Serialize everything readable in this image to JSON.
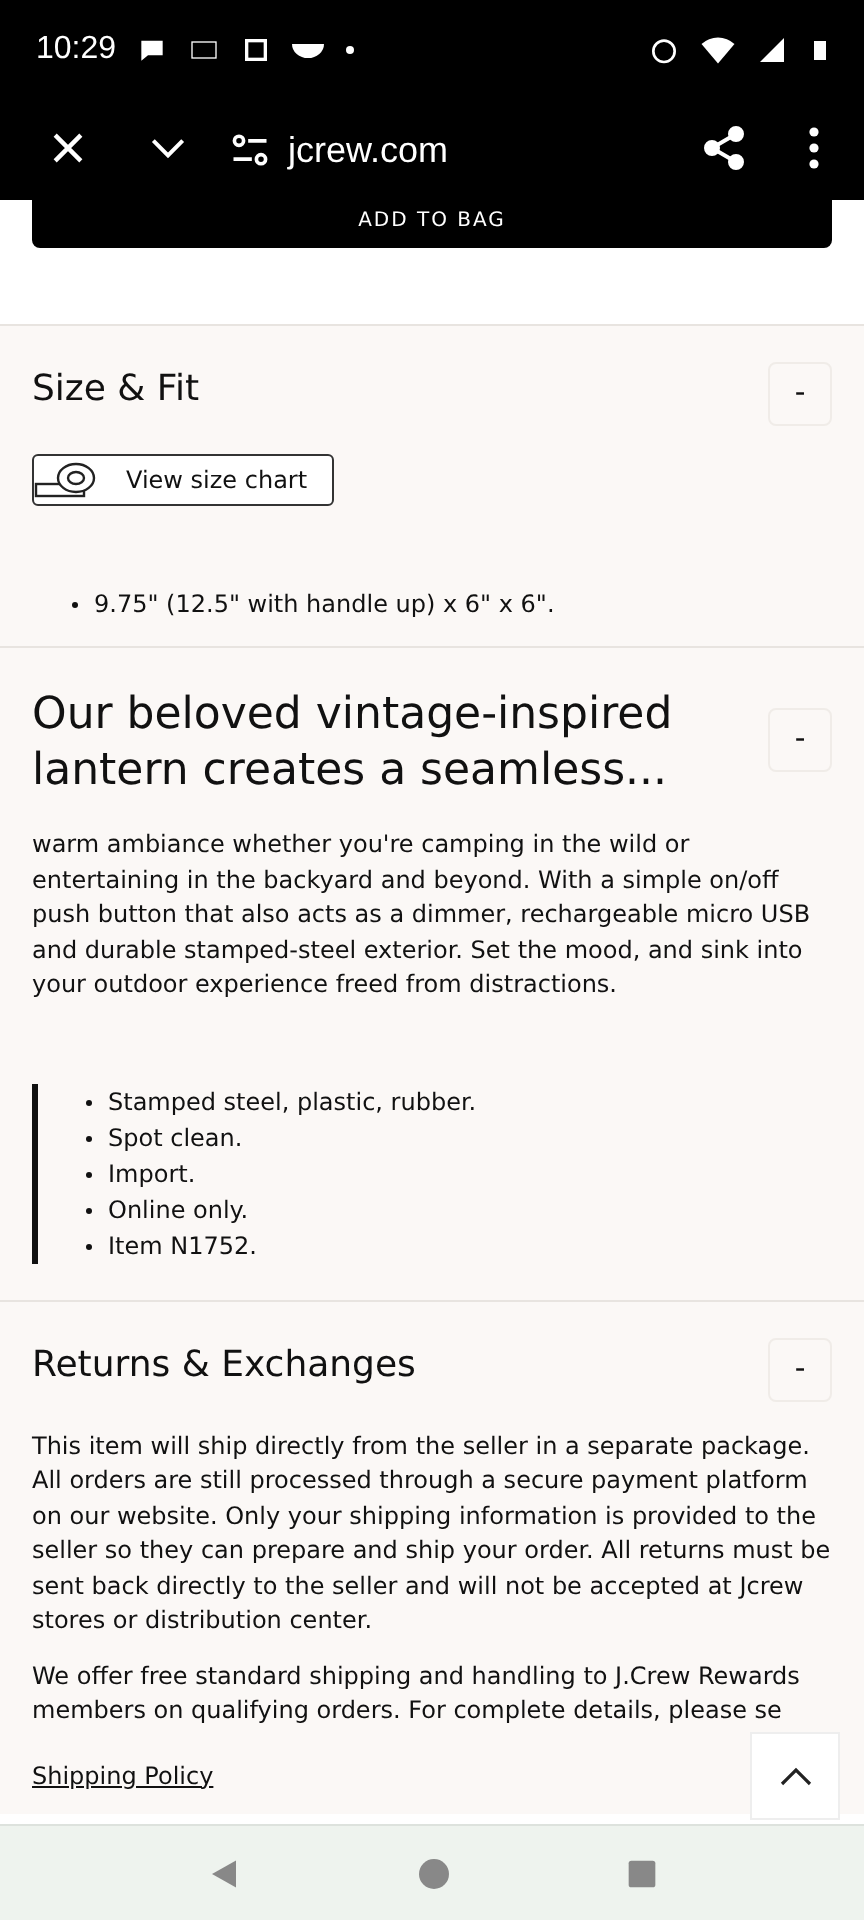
{
  "status_bar": {
    "time": "10:29"
  },
  "browser_toolbar": {
    "url": "jcrew.com"
  },
  "add_to_bag_button": {
    "label": "ADD TO BAG"
  },
  "sections": [
    {
      "kind": "size",
      "title": "Size & Fit",
      "toggle": "-",
      "expanded": true,
      "size_chart_button": "View size chart",
      "bullets": [
        "9.75\" (12.5\" with handle up) x 6\" x 6\"."
      ]
    },
    {
      "kind": "description",
      "title": "Our beloved vintage-inspired lantern creates a seamless...",
      "toggle": "-",
      "expanded": true,
      "paragraph": "warm ambiance whether you're camping in the wild or entertaining in the backyard and beyond. With a simple on/off push button that also acts as a dimmer, rechargeable micro USB and durable stamped-steel exterior. Set the mood, and sink into your outdoor experience freed from distractions.",
      "bullets": [
        "Stamped steel, plastic, rubber.",
        "Spot clean.",
        "Import.",
        "Online only.",
        "Item N1752."
      ]
    },
    {
      "kind": "returns",
      "title": "Returns & Exchanges",
      "toggle": "-",
      "expanded": true,
      "paragraphs": [
        "This item will ship directly from the seller in a separate package. All orders are still processed through a secure payment platform on our website. Only your shipping information is provided to the seller so they can prepare and ship your order. All returns must be sent back directly to the seller and will not be accepted at Jcrew stores or distribution center.",
        "We offer free standard shipping and handling to J.Crew Rewards members on qualifying orders. For complete details, please se"
      ],
      "link": "Shipping Policy"
    }
  ]
}
